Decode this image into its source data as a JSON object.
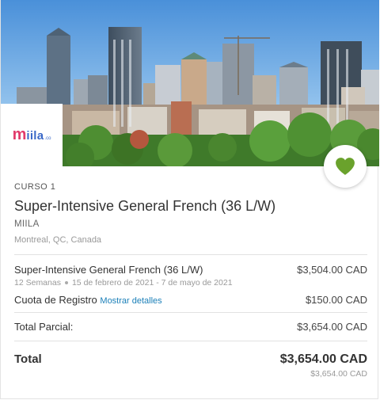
{
  "hero": {
    "image_alt": "Montreal skyline",
    "logo": {
      "m": "m",
      "rest": "iila",
      "tld": ".co"
    }
  },
  "favorite": {
    "icon": "heart-icon",
    "color": "#6aa22c"
  },
  "course": {
    "eyebrow": "CURSO 1",
    "title": "Super-Intensive General French (36 L/W)",
    "school": "MIILA",
    "location": "Montreal, QC, Canada"
  },
  "lines": {
    "course_label": "Super-Intensive General French (36 L/W)",
    "course_price": "$3,504.00 CAD",
    "duration": "12 Semanas",
    "dates": "15 de febrero de 2021 - 7 de mayo de 2021",
    "fee_label": "Cuota de Registro",
    "fee_link": "Mostrar detalles",
    "fee_price": "$150.00 CAD"
  },
  "subtotal": {
    "label": "Total Parcial:",
    "value": "$3,654.00 CAD"
  },
  "total": {
    "label": "Total",
    "value": "$3,654.00 CAD",
    "secondary": "$3,654.00 CAD"
  },
  "colors": {
    "accent_link": "#1a7fb8",
    "heart": "#6aa22c"
  }
}
